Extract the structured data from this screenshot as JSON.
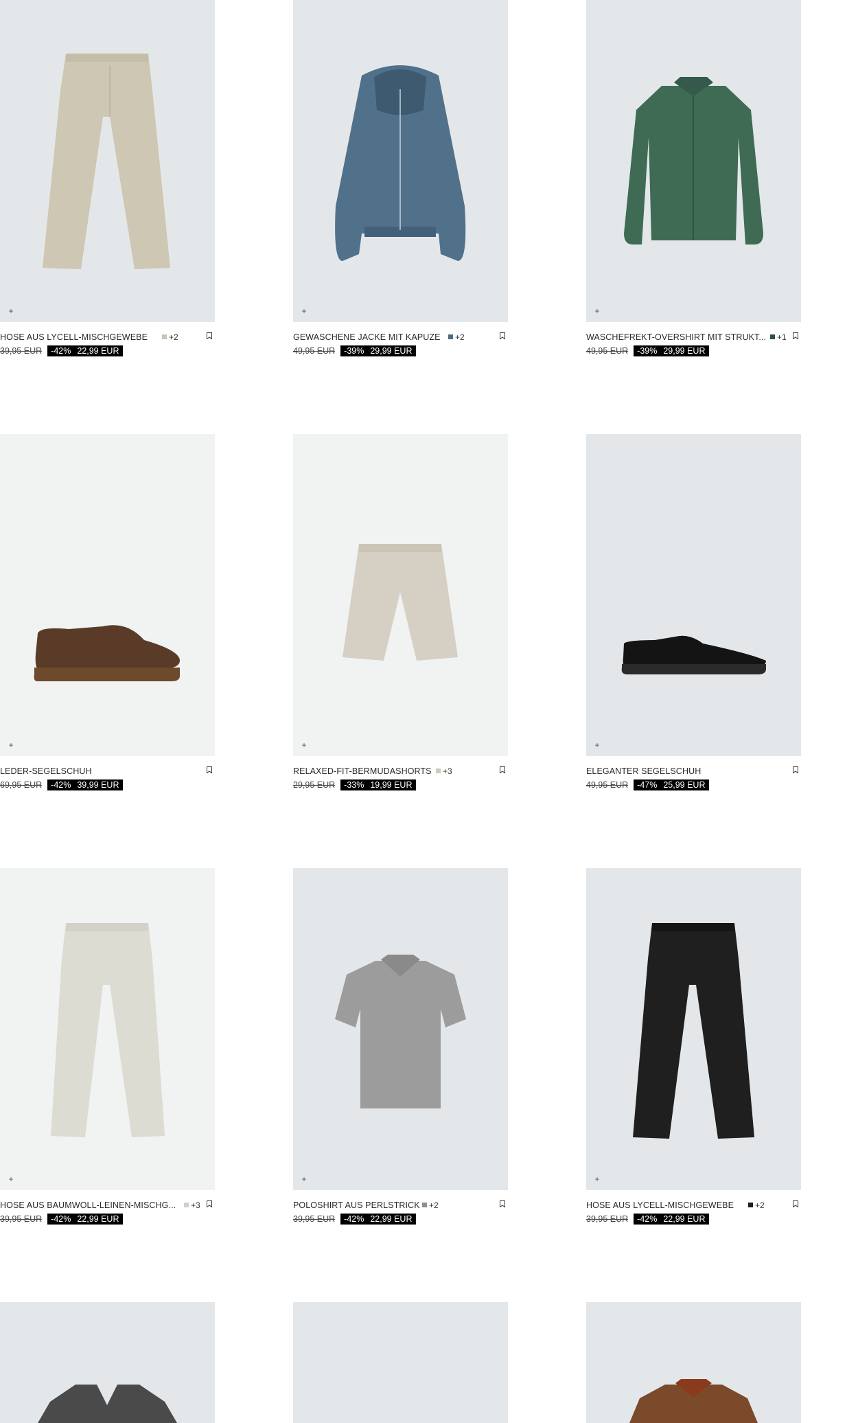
{
  "products": [
    {
      "name": "HOSE AUS LYCELL-MISCHGEWEBE",
      "swatch_color": "#c9c3b2",
      "swatch_more": "+2",
      "old_price": "39,95 EUR",
      "discount": "-42%",
      "price": "22,99 EUR",
      "image": "trousers-beige"
    },
    {
      "name": "GEWASCHENE JACKE MIT KAPUZE",
      "swatch_color": "#4e6a7e",
      "swatch_more": "+2",
      "old_price": "49,95 EUR",
      "discount": "-39%",
      "price": "29,99 EUR",
      "image": "denim-hooded-jacket"
    },
    {
      "name": "WASCHEFREKT-OVERSHIRT MIT STRUKT...",
      "swatch_color": "#2f4f44",
      "swatch_more": "+1",
      "old_price": "49,95 EUR",
      "discount": "-39%",
      "price": "29,99 EUR",
      "image": "green-overshirt"
    },
    {
      "name": "LEDER-SEGELSCHUH",
      "swatch_color": "",
      "swatch_more": "",
      "old_price": "69,95 EUR",
      "discount": "-42%",
      "price": "39,99 EUR",
      "image": "brown-boat-shoe"
    },
    {
      "name": "RELAXED-FIT-BERMUDASHORTS",
      "swatch_color": "#cfcabd",
      "swatch_more": "+3",
      "old_price": "29,95 EUR",
      "discount": "-33%",
      "price": "19,99 EUR",
      "image": "beige-shorts"
    },
    {
      "name": "ELEGANTER SEGELSCHUH",
      "swatch_color": "",
      "swatch_more": "",
      "old_price": "49,95 EUR",
      "discount": "-47%",
      "price": "25,99 EUR",
      "image": "black-boat-shoe"
    },
    {
      "name": "HOSE AUS BAUMWOLL-LEINEN-MISCHG...",
      "swatch_color": "#cfd0c8",
      "swatch_more": "+3",
      "old_price": "39,95 EUR",
      "discount": "-42%",
      "price": "22,99 EUR",
      "image": "light-trousers"
    },
    {
      "name": "POLOSHIRT AUS PERLSTRICK",
      "swatch_color": "#8e8e8e",
      "swatch_more": "+2",
      "old_price": "39,95 EUR",
      "discount": "-42%",
      "price": "22,99 EUR",
      "image": "grey-polo"
    },
    {
      "name": "HOSE AUS LYCELL-MISCHGEWEBE",
      "swatch_color": "#1e1e1e",
      "swatch_more": "+2",
      "old_price": "39,95 EUR",
      "discount": "-42%",
      "price": "22,99 EUR",
      "image": "black-trousers"
    },
    {
      "name": "",
      "image": "grey-blazer"
    },
    {
      "name": "",
      "image": "empty"
    },
    {
      "name": "",
      "image": "brown-jacket"
    }
  ],
  "icons": {
    "add": "+",
    "bookmark": "bookmark-icon"
  }
}
